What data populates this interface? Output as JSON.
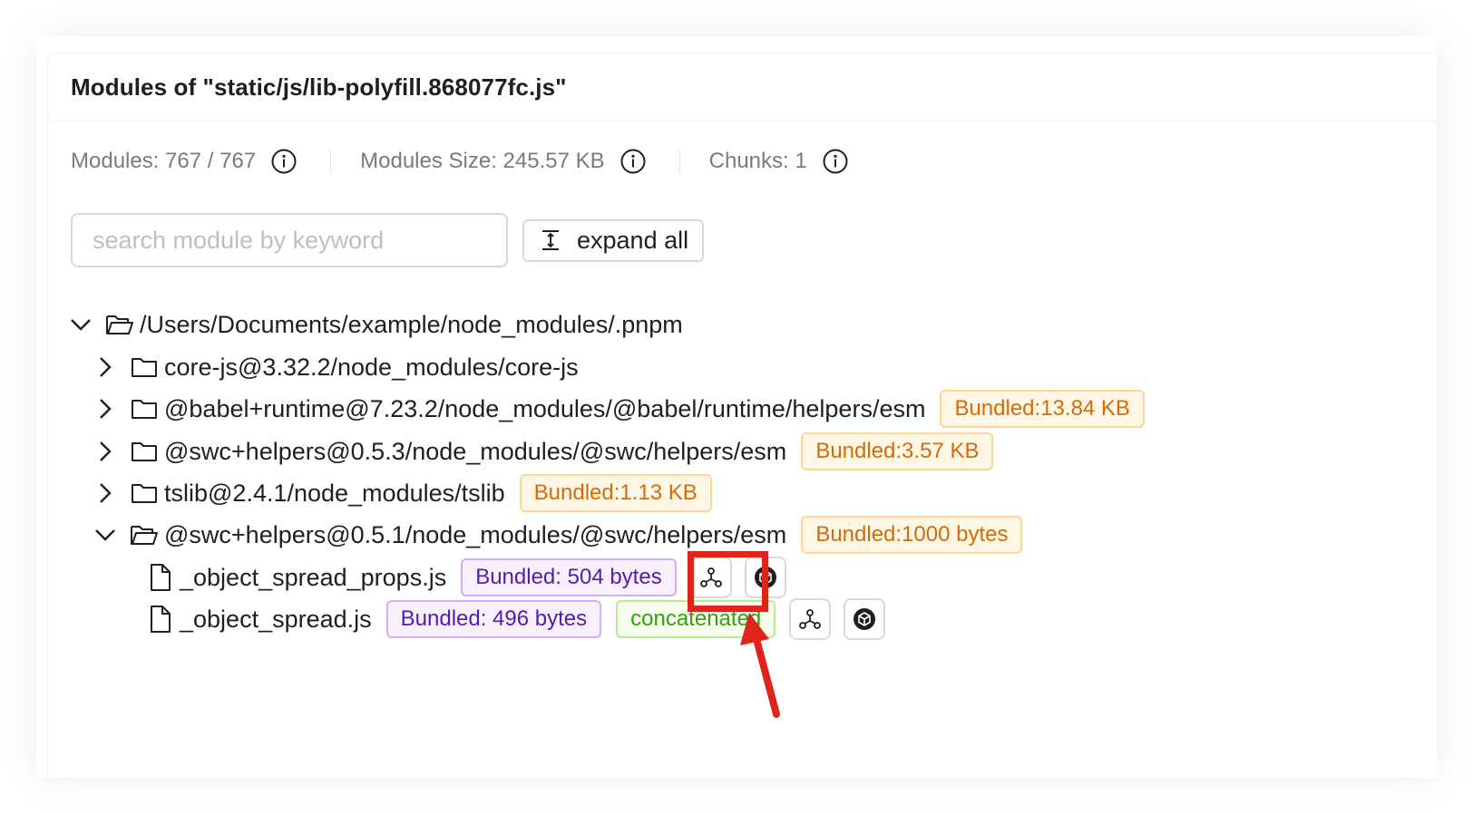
{
  "panel": {
    "title": "Modules of \"static/js/lib-polyfill.868077fc.js\""
  },
  "stats": {
    "modules": "Modules: 767 / 767",
    "modules_size": "Modules Size: 245.57 KB",
    "chunks": "Chunks: 1"
  },
  "search": {
    "placeholder": "search module by keyword",
    "value": ""
  },
  "toolbar": {
    "expand_label": "expand all"
  },
  "tree": {
    "root": {
      "label": "/Users/Documents/example/node_modules/.pnpm",
      "expanded": true
    },
    "folders": [
      {
        "label": "core-js@3.32.2/node_modules/core-js",
        "tag": "",
        "expanded": false
      },
      {
        "label": "@babel+runtime@7.23.2/node_modules/@babel/runtime/helpers/esm",
        "tag": "Bundled:13.84 KB",
        "expanded": false
      },
      {
        "label": "@swc+helpers@0.5.3/node_modules/@swc/helpers/esm",
        "tag": "Bundled:3.57 KB",
        "expanded": false
      },
      {
        "label": "tslib@2.4.1/node_modules/tslib",
        "tag": "Bundled:1.13 KB",
        "expanded": false
      },
      {
        "label": "@swc+helpers@0.5.1/node_modules/@swc/helpers/esm",
        "tag": "Bundled:1000 bytes",
        "expanded": true
      }
    ],
    "files": [
      {
        "label": "_object_spread_props.js",
        "bundled": "Bundled: 504 bytes",
        "concatenated": ""
      },
      {
        "label": "_object_spread.js",
        "bundled": "Bundled: 496 bytes",
        "concatenated": "concatenated"
      }
    ]
  },
  "icons": {
    "info": "info-circle-icon",
    "expand": "column-height-icon",
    "caret_open": "chevron-down-icon",
    "caret_closed": "chevron-right-icon",
    "folder_open": "folder-open-icon",
    "folder_closed": "folder-icon",
    "file": "file-icon",
    "graph": "module-graph-icon",
    "codepen": "code-sandbox-icon"
  },
  "colors": {
    "tag_orange": "#d46b08",
    "tag_purple": "#531dab",
    "tag_green": "#389e0d",
    "annotation_red": "#e0241b"
  }
}
